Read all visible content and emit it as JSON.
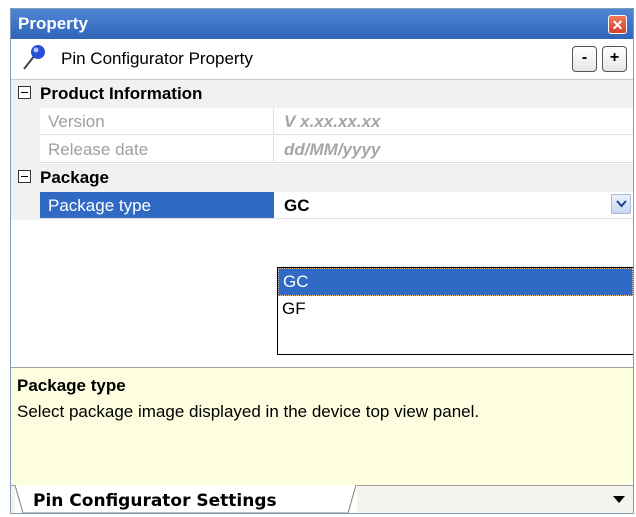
{
  "window": {
    "title": "Property",
    "close_glyph": "✕"
  },
  "header": {
    "label": "Pin Configurator Property",
    "minus_label": "-",
    "plus_label": "+",
    "icon": "pin-icon"
  },
  "grid": {
    "categories": [
      {
        "label": "Product Information",
        "properties": [
          {
            "name": "Version",
            "value": "V x.xx.xx.xx"
          },
          {
            "name": "Release date",
            "value": "dd/MM/yyyy"
          }
        ]
      },
      {
        "label": "Package",
        "properties": [
          {
            "name": "Package type",
            "value": "GC"
          }
        ]
      }
    ]
  },
  "dropdown": {
    "options": [
      "GC",
      "GF"
    ],
    "selected": "GC"
  },
  "description": {
    "title": "Package type",
    "text": "Select package image displayed in the device top view panel."
  },
  "tabs": [
    {
      "label": "Pin Configurator Settings"
    }
  ],
  "colors": {
    "titlebar": "#3f74c7",
    "selection": "#316ac5",
    "description_bg": "#fdfde0"
  }
}
